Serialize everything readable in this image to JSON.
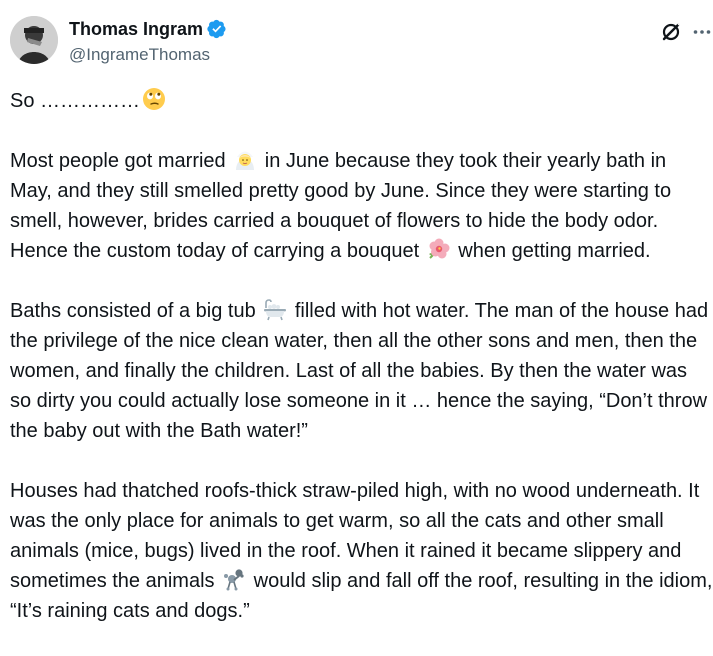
{
  "author": {
    "display_name": "Thomas Ingram",
    "handle": "@IngrameThomas",
    "verified_icon": "verified-badge-icon",
    "verified_color": "#1d9bf0"
  },
  "actions": {
    "grok_icon": "grok-icon",
    "more_icon": "more-dots-icon"
  },
  "tweet": {
    "p1": {
      "text": "So ……………",
      "emoji": "face-with-rolling-eyes-emoji"
    },
    "p2": {
      "t1": "Most people got married",
      "emoji1": "person-with-veil-emoji",
      "t2": "in June because they took their yearly bath in May, and they still smelled pretty good by June. Since they were starting to smell, however, brides carried a bouquet of flowers to hide the body odor. Hence the custom today of carrying a bouquet",
      "emoji2": "hibiscus-emoji",
      "t3": "when getting married."
    },
    "p3": {
      "t1": "Baths consisted of a big tub",
      "emoji1": "bathtub-emoji",
      "t2": "filled with hot water. The man of the house had the privilege of the nice clean water, then all the other sons and men, then the women, and finally the children. Last of all the babies. By then the water was so dirty you could actually lose someone in it … hence the saying, “Don’t throw the baby out with the Bath water!”"
    },
    "p4": {
      "t1": "Houses had thatched roofs-thick straw-piled high, with no wood underneath. It was the only place for animals to get warm, so all the cats and other small animals (mice, bugs) lived in the roof. When it rained it became slippery and sometimes the animals",
      "emoji1": "poodle-emoji",
      "t2": "would slip and fall off the roof, resulting in the idiom, “It’s raining cats and dogs.”"
    }
  }
}
